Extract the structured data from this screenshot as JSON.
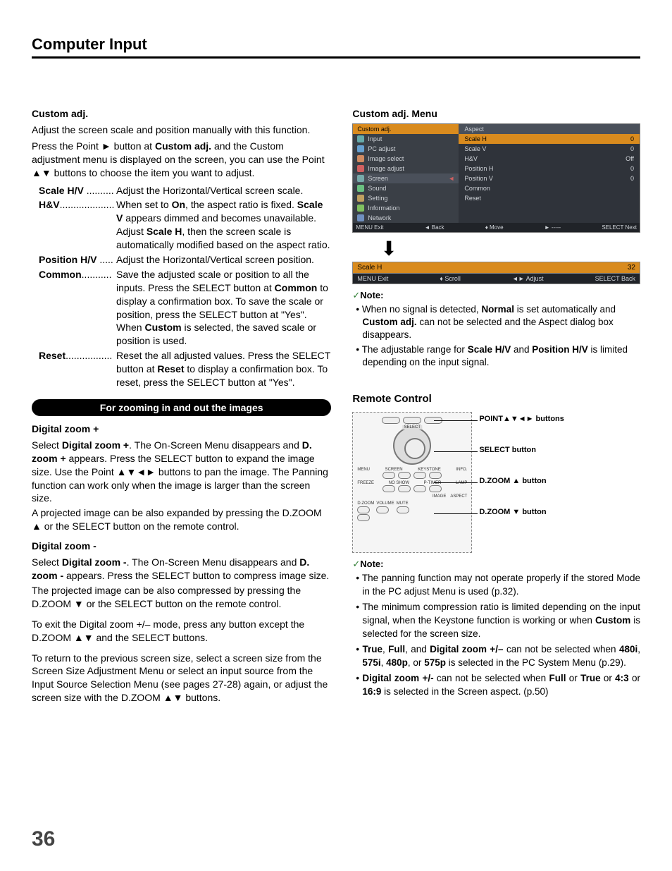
{
  "header": {
    "title": "Computer Input"
  },
  "page_number": "36",
  "left": {
    "custom_adj_h": "Custom adj.",
    "custom_adj_p1": "Adjust the screen scale and position manually with this function.",
    "custom_adj_p2_a": "Press the Point ► button at ",
    "custom_adj_p2_b": "Custom adj.",
    "custom_adj_p2_c": " and the Custom adjustment menu is displayed on the screen, you can use the Point ▲▼ buttons to choose the item you want to adjust.",
    "defs": {
      "scale_hv_t": "Scale H/V",
      "scale_hv_d": "Adjust the Horizontal/Vertical screen scale.",
      "hv_t": "H&V",
      "hv_d_a": "When set to ",
      "hv_d_b": "On",
      "hv_d_c": ", the aspect ratio is fixed. ",
      "hv_d_d": "Scale V",
      "hv_d_e": " appears dimmed and becomes unavailable. Adjust ",
      "hv_d_f": "Scale H",
      "hv_d_g": ", then the screen scale is automatically modified based on the aspect ratio.",
      "pos_t": "Position H/V",
      "pos_d": "Adjust the Horizontal/Vertical screen position.",
      "common_t": "Common",
      "common_d_a": "Save the adjusted scale or position to all the inputs. Press the SELECT button at ",
      "common_d_b": "Common",
      "common_d_c": " to display a confirmation box. To save the scale or position, press the SELECT button at \"Yes\". When ",
      "common_d_d": "Custom",
      "common_d_e": " is selected, the saved scale or position is used.",
      "reset_t": "Reset",
      "reset_d_a": "Reset the all adjusted values. Press the SELECT button at ",
      "reset_d_b": "Reset",
      "reset_d_c": " to display a confirmation box. To reset, press the SELECT button at \"Yes\"."
    },
    "zoom_pill": "For zooming in and out the images",
    "dz_plus_h": "Digital zoom +",
    "dz_plus_p1_a": "Select ",
    "dz_plus_p1_b": "Digital zoom +",
    "dz_plus_p1_c": ". The On-Screen Menu disappears and ",
    "dz_plus_p1_d": "D. zoom +",
    "dz_plus_p1_e": " appears. Press the SELECT button to expand the image size. Use the Point ▲▼◄► buttons to pan the image. The Panning function can work only when the image is larger than the screen size.",
    "dz_plus_p2": "A projected image can be also expanded by pressing the D.ZOOM ▲ or the SELECT button on the remote control.",
    "dz_minus_h": "Digital zoom -",
    "dz_minus_p1_a": "Select ",
    "dz_minus_p1_b": "Digital zoom -",
    "dz_minus_p1_c": ". The On-Screen Menu disappears and ",
    "dz_minus_p1_d": "D. zoom -",
    "dz_minus_p1_e": " appears. Press the SELECT button to compress image size.",
    "dz_minus_p2": "The projected image can be also compressed by pressing the D.ZOOM ▼ or the SELECT button on the remote control.",
    "dz_exit": "To exit the Digital zoom +/– mode, press any button except the D.ZOOM ▲▼ and the SELECT buttons.",
    "dz_return": "To return to the previous screen size, select a screen size from the Screen Size Adjustment Menu or select an input source from the Input Source Selection Menu (see pages 27-28) again, or adjust the screen size with the D.ZOOM ▲▼ buttons."
  },
  "right": {
    "menu_h": "Custom adj. Menu",
    "menu_left_header": "Custom adj.",
    "menu_left_items": [
      "Input",
      "PC adjust",
      "Image select",
      "Image adjust",
      "Screen",
      "Sound",
      "Setting",
      "Information",
      "Network"
    ],
    "menu_right_header": "Aspect",
    "menu_right_rows": [
      {
        "label": "Scale H",
        "val": "0",
        "sel": true
      },
      {
        "label": "Scale V",
        "val": "0"
      },
      {
        "label": "H&V",
        "val": "Off"
      },
      {
        "label": "Position H",
        "val": "0"
      },
      {
        "label": "Position V",
        "val": "0"
      },
      {
        "label": "Common",
        "val": ""
      },
      {
        "label": "Reset",
        "val": ""
      }
    ],
    "menu_bottom": [
      "MENU Exit",
      "◄ Back",
      "♦ Move",
      "► -----",
      "SELECT Next"
    ],
    "scale_bar_label": "Scale H",
    "scale_bar_val": "32",
    "scale_bar_bottom": [
      "MENU Exit",
      "♦ Scroll",
      "◄► Adjust",
      "SELECT Back"
    ],
    "note_h": "Note:",
    "note1_a": "When no signal is detected, ",
    "note1_b": "Normal",
    "note1_c": " is set automatically and ",
    "note1_d": "Custom adj.",
    "note1_e": " can not be selected and the Aspect dialog box disappears.",
    "note2_a": "The adjustable range for ",
    "note2_b": "Scale H/V",
    "note2_c": " and ",
    "note2_d": "Position H/V",
    "note2_e": " is limited depending on the input signal.",
    "remote_h": "Remote Control",
    "rc_select": "SELECT",
    "rc_row_labels": [
      "MENU",
      "SCREEN",
      "KEYSTONE",
      "INFO."
    ],
    "rc_row_labels2": [
      "FREEZE",
      "NO SHOW",
      "P-TIMER",
      "LAMP"
    ],
    "rc_img_aspect": [
      "IMAGE",
      "ASPECT"
    ],
    "rc_dzoom": "D.ZOOM",
    "rc_vol_mute": [
      "VOLUME",
      "MUTE"
    ],
    "callouts": {
      "point": "POINT▲▼◄► buttons",
      "select": "SELECT button",
      "dz_up": "D.ZOOM ▲ button",
      "dz_dn": "D.ZOOM ▼ button"
    },
    "note2_h": "Note:",
    "n2_1": "The panning function may not operate properly if the stored Mode in the PC adjust Menu is used (p.32).",
    "n2_2_a": "The minimum compression ratio is limited depending on the input signal, when the Keystone function is working or when ",
    "n2_2_b": "Custom",
    "n2_2_c": " is selected for the screen size.",
    "n2_3_a": "True",
    "n2_3_b": ", ",
    "n2_3_c": "Full",
    "n2_3_d": ", and ",
    "n2_3_e": "Digital zoom +/–",
    "n2_3_f": " can not be selected when ",
    "n2_3_g": "480i",
    "n2_3_h": ", ",
    "n2_3_i": "575i",
    "n2_3_j": ", ",
    "n2_3_k": "480p",
    "n2_3_l": ", or ",
    "n2_3_m": "575p",
    "n2_3_n": " is selected in the PC System Menu (p.29).",
    "n2_4_a": "Digital zoom +/-",
    "n2_4_b": " can not be selected when ",
    "n2_4_c": "Full",
    "n2_4_d": " or ",
    "n2_4_e": "True",
    "n2_4_f": " or ",
    "n2_4_g": "4:3",
    "n2_4_h": " or ",
    "n2_4_i": "16:9",
    "n2_4_j": "  is selected in the Screen aspect. (p.50)"
  }
}
